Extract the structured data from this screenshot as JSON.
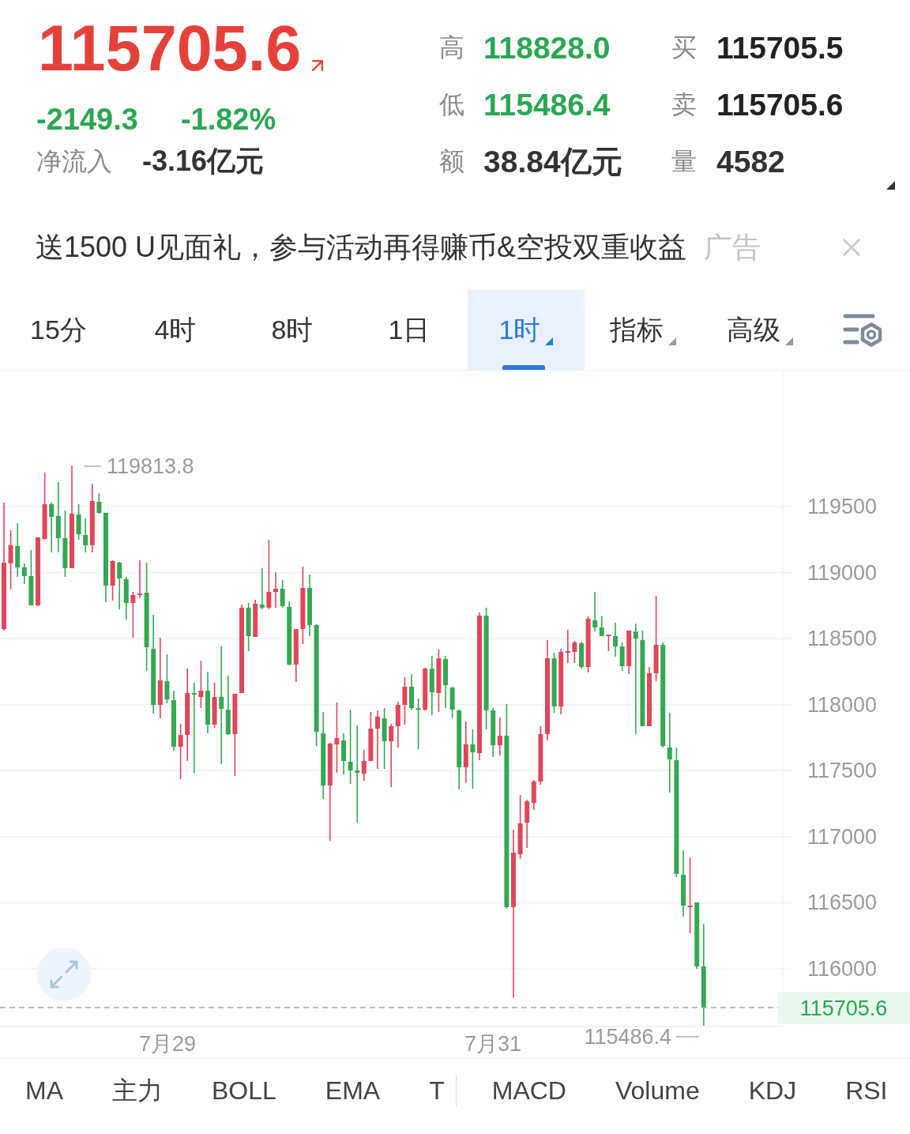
{
  "quote": {
    "price": "115705.6",
    "price_rising": true,
    "change": "-2149.3",
    "change_percent": "-1.82%",
    "change_rising": false,
    "net_inflow_label": "净流入",
    "net_inflow": "-3.16亿元"
  },
  "stats": [
    {
      "label": "高",
      "value": "118828.0",
      "color": "#2aa752"
    },
    {
      "label": "买",
      "value": "115705.5",
      "color": "#222222"
    },
    {
      "label": "低",
      "value": "115486.4",
      "color": "#2aa752"
    },
    {
      "label": "卖",
      "value": "115705.6",
      "color": "#222222"
    },
    {
      "label": "额",
      "value": "38.84亿元",
      "color": "#333333"
    },
    {
      "label": "量",
      "value": "4582",
      "color": "#333333"
    }
  ],
  "banner": {
    "text": "送1500 U见面礼，参与活动再得赚币&空投双重收益",
    "tag": "广告"
  },
  "timeframes": [
    {
      "label": "15分",
      "selected": false,
      "dropdown": false
    },
    {
      "label": "4时",
      "selected": false,
      "dropdown": false
    },
    {
      "label": "8时",
      "selected": false,
      "dropdown": false
    },
    {
      "label": "1日",
      "selected": false,
      "dropdown": false
    },
    {
      "label": "1时",
      "selected": true,
      "dropdown": true
    },
    {
      "label": "指标",
      "selected": false,
      "dropdown": true
    },
    {
      "label": "高级",
      "selected": false,
      "dropdown": true
    }
  ],
  "chart": {
    "price_axis": [
      "119500",
      "119000",
      "118500",
      "118000",
      "117500",
      "117000",
      "116500",
      "116000"
    ],
    "date_axis": [
      "7月29",
      "7月31"
    ],
    "high_label": "119813.8",
    "low_label": "115486.4",
    "last_price": "115705.6"
  },
  "indicators": {
    "main": [
      "MA",
      "主力",
      "BOLL",
      "EMA",
      "T"
    ],
    "sub": [
      "MACD",
      "Volume",
      "KDJ",
      "RSI"
    ]
  }
}
